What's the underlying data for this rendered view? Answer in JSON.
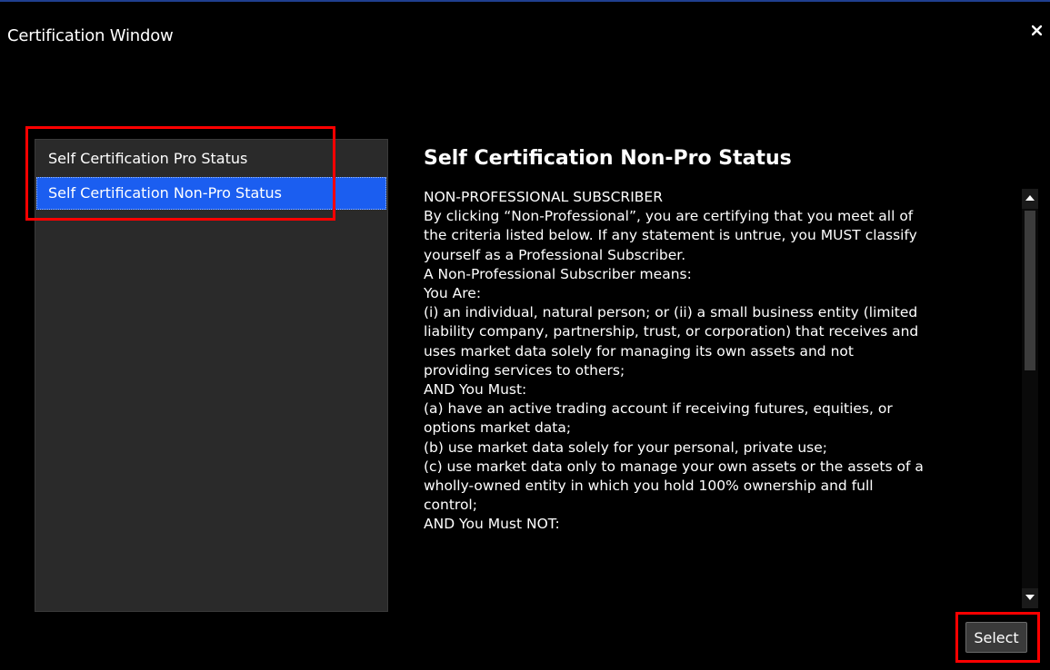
{
  "window": {
    "title": "Certification Window",
    "close_icon": "close-icon"
  },
  "list": {
    "items": [
      {
        "label": "Self Certification Pro Status",
        "selected": false
      },
      {
        "label": "Self Certification Non-Pro Status",
        "selected": true
      }
    ]
  },
  "content": {
    "title": "Self Certification Non-Pro Status",
    "lines": [
      "NON-PROFESSIONAL SUBSCRIBER",
      "By clicking “Non-Professional”, you are certifying that you meet all of",
      "the criteria listed below. If any statement is untrue, you MUST classify",
      "yourself as a Professional Subscriber.",
      "A Non-Professional Subscriber means:",
      "You Are:",
      "(i) an individual, natural person; or (ii) a small business entity (limited",
      "liability company, partnership, trust, or corporation) that receives and",
      "uses market data solely for managing its own assets and not",
      "providing services to others;",
      "AND You Must:",
      "(a) have an active trading account if receiving futures, equities, or",
      "options market data;",
      "(b) use market data solely for your personal, private use;",
      "(c) use market data only to manage your own assets or the assets of a",
      "wholly-owned entity in which you hold 100% ownership and full",
      "control;",
      "AND You Must NOT:"
    ]
  },
  "actions": {
    "select_label": "Select"
  },
  "colors": {
    "background": "#000000",
    "list_background": "#2a2a2a",
    "selection": "#1b5ef0",
    "highlight": "#ff0000"
  }
}
